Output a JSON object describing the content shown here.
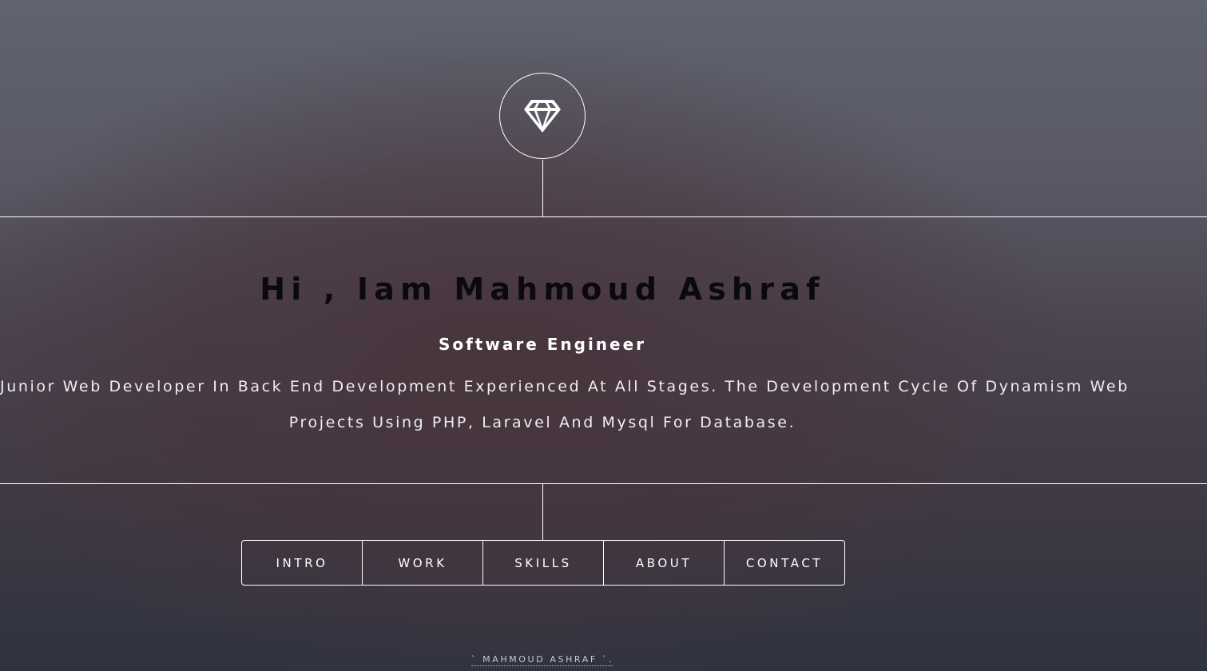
{
  "logo": {
    "icon": "diamond-icon"
  },
  "hero": {
    "headline": "Hi , Iam Mahmoud Ashraf",
    "subtitle": "Software Engineer",
    "description_line1": "Junior Web Developer In Back End Development Experienced At All Stages. The Development Cycle Of Dynamism Web",
    "description_line2": "Projects Using PHP, Laravel And Mysql For Database."
  },
  "nav": {
    "items": [
      {
        "label": "INTRO"
      },
      {
        "label": "WORK"
      },
      {
        "label": "SKILLS"
      },
      {
        "label": "ABOUT"
      },
      {
        "label": "CONTACT"
      }
    ]
  },
  "footer": {
    "text": "` MAHMOUD ASHRAF `."
  },
  "colors": {
    "line": "#ffffff",
    "headline": "#0a0a0c",
    "background_top": "#5f6470",
    "background_bottom": "#2f3340"
  }
}
